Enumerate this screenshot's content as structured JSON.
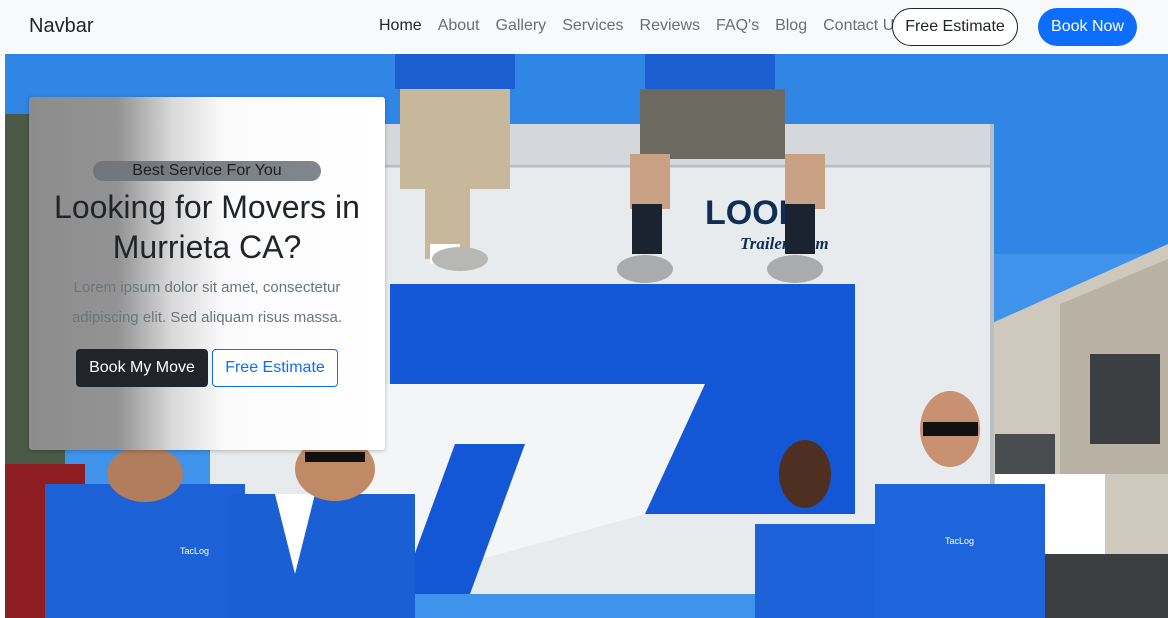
{
  "navbar": {
    "brand": "Navbar",
    "links": [
      {
        "label": "Home",
        "active": true
      },
      {
        "label": "About"
      },
      {
        "label": "Gallery"
      },
      {
        "label": "Services"
      },
      {
        "label": "Reviews"
      },
      {
        "label": "FAQ's"
      },
      {
        "label": "Blog"
      },
      {
        "label": "Contact Us"
      }
    ],
    "estimate_label": "Free Estimate",
    "book_label": "Book Now"
  },
  "hero": {
    "badge": "Best Service For You",
    "title": "Looking for Movers in Murrieta CA?",
    "text": "Lorem ipsum dolor sit amet, consectetur adipiscing elit. Sed aliquam risus massa.",
    "primary_button": "Book My Move",
    "secondary_button": "Free Estimate",
    "image_text": {
      "truck_logo": "LOOK",
      "truck_subtext": "Trailers.com",
      "shirt_logo": "TacLog"
    }
  },
  "colors": {
    "primary": "#0d6efd",
    "dark": "#212529",
    "navbar_bg": "#f8f9fa",
    "muted": "#6c757d"
  }
}
